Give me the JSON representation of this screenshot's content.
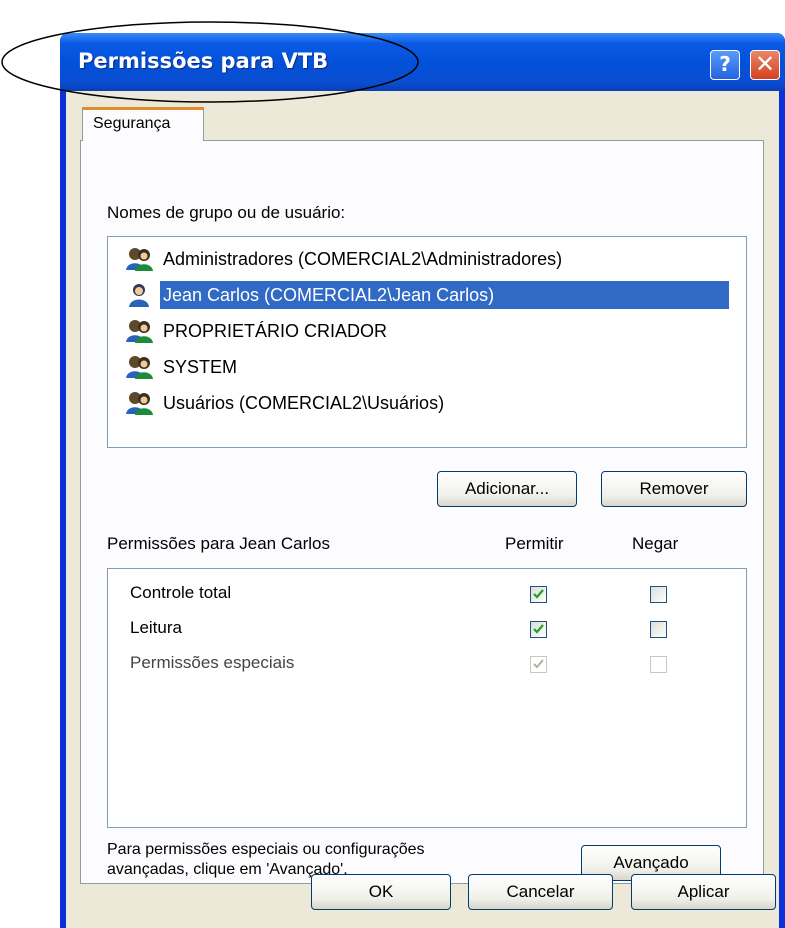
{
  "window": {
    "title": "Permissões para VTB",
    "help_glyph": "?",
    "close_glyph": "✕"
  },
  "tabs": [
    {
      "label": "Segurança",
      "active": true
    }
  ],
  "groups": {
    "label": "Nomes de grupo ou de usuário:",
    "items": [
      {
        "name": "Administradores (COMERCIAL2\\Administradores)",
        "icon": "group-users-icon",
        "selected": false
      },
      {
        "name": "Jean Carlos (COMERCIAL2\\Jean Carlos)",
        "icon": "user-icon",
        "selected": true
      },
      {
        "name": "PROPRIETÁRIO CRIADOR",
        "icon": "group-users-icon",
        "selected": false
      },
      {
        "name": "SYSTEM",
        "icon": "group-users-icon",
        "selected": false
      },
      {
        "name": "Usuários (COMERCIAL2\\Usuários)",
        "icon": "group-users-icon",
        "selected": false
      }
    ]
  },
  "buttons": {
    "add": "Adicionar...",
    "remove": "Remover",
    "advanced": "Avançado",
    "ok": "OK",
    "cancel": "Cancelar",
    "apply": "Aplicar"
  },
  "permissions": {
    "label": "Permissões para Jean Carlos",
    "allow_header": "Permitir",
    "deny_header": "Negar",
    "rows": [
      {
        "name": "Controle total",
        "allow": true,
        "deny": false,
        "enabled": true
      },
      {
        "name": "Leitura",
        "allow": true,
        "deny": false,
        "enabled": true
      },
      {
        "name": "Permissões especiais",
        "allow": true,
        "deny": false,
        "enabled": false
      }
    ]
  },
  "advanced_note": {
    "line1": "Para permissões especiais ou configurações",
    "line2": "avançadas, clique em 'Avançado'."
  },
  "colors": {
    "selection": "#316ac5",
    "titlebar": "#0a5ae6",
    "dialog_bg": "#ece9d8",
    "tab_accent": "#e68b2c",
    "check": "#21a121"
  }
}
